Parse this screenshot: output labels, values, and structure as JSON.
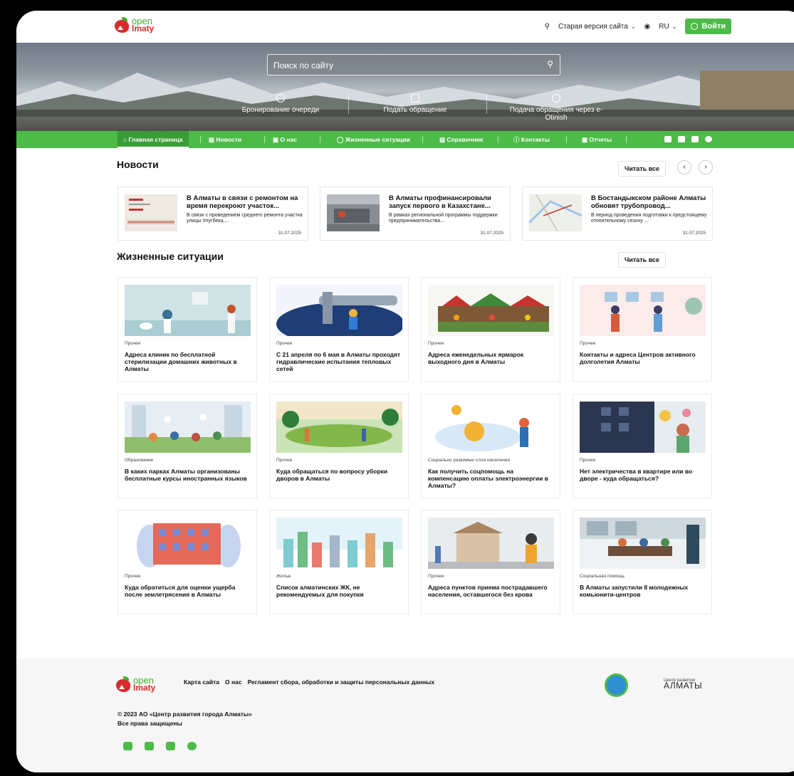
{
  "header": {
    "logo_line1": "open",
    "logo_line2": "lmaty",
    "old_version": "Старая версия сайта",
    "lang": "RU",
    "login": "Войти"
  },
  "hero": {
    "search_placeholder": "Поиск по сайту",
    "links": [
      "Бронирование очереди",
      "Подать обращение",
      "Подача обращения через e-Otinish"
    ]
  },
  "nav": {
    "items": [
      "Главная страница",
      "Новости",
      "О нас",
      "Жизненные ситуации",
      "Справочник",
      "Контакты",
      "Отчеты"
    ]
  },
  "news": {
    "title": "Новости",
    "read_all": "Читать все",
    "prev": "‹",
    "next": "›",
    "items": [
      {
        "title": "В Алматы в связи с ремонтом на время перекроют участок...",
        "desc": "В связи с проведением среднего ремонта участка улицы Улугбека,...",
        "date": "31.07.2025"
      },
      {
        "title": "В Алматы профинансировали запуск первого в Казахстане...",
        "desc": "В рамках региональной программы поддержки предпринимательства...",
        "date": "31.07.2025"
      },
      {
        "title": "В Бостандыкском районе Алматы обновят трубопровод...",
        "desc": "В период проведения подготовки к предстоящему отопительному сезону ...",
        "date": "31.07.2025"
      }
    ]
  },
  "life": {
    "title": "Жизненные ситуации",
    "read_all": "Читать все",
    "items": [
      {
        "cat": "Прочее",
        "title": "Адреса клиник по бесплатной стерилизации домашних животных в Алматы"
      },
      {
        "cat": "Прочее",
        "title": "С 21 апреля по 6 мая в Алматы проходят гидравлические испытания тепловых сетей"
      },
      {
        "cat": "Прочее",
        "title": "Адреса еженедельных ярмарок выходного дня в Алматы"
      },
      {
        "cat": "Прочее",
        "title": "Контакты и адреса Центров активного долголетия Алматы"
      },
      {
        "cat": "Образование",
        "title": "В каких парках Алматы организованы бесплатные курсы иностранных языков"
      },
      {
        "cat": "Прочее",
        "title": "Куда обращаться по вопросу уборки дворов в Алматы"
      },
      {
        "cat": "Социально уязвимые слои населения",
        "title": "Как получить соцпомощь на компенсацию оплаты электроэнергии в Алматы?"
      },
      {
        "cat": "Прочее",
        "title": "Нет электричества в квартире или во дворе - куда обращаться?"
      },
      {
        "cat": "Прочее",
        "title": "Куда обратиться для оценки ущерба после землетрясения в Алматы"
      },
      {
        "cat": "Жилье",
        "title": "Список алматинских ЖК, не рекомендуемых для покупки"
      },
      {
        "cat": "Прочее",
        "title": "Адреса пунктов приема пострадавшего населения, оставшегося без крова"
      },
      {
        "cat": "Социальная помощь",
        "title": "В Алматы запустили 8 молодежных комьюнити-центров"
      }
    ]
  },
  "footer": {
    "links": [
      "Карта сайта",
      "О нас",
      "Регламент сбора, обработки и защиты персональных данных"
    ],
    "copyright_line1": "© 2023 АО «Центр развития города Алматы»",
    "copyright_line2": "Все права защищены",
    "cra_small": "Центр развития",
    "cra_big": "АЛМАТЫ"
  },
  "colors": {
    "accent": "#4cbb47",
    "brand_red": "#d92b2b"
  }
}
